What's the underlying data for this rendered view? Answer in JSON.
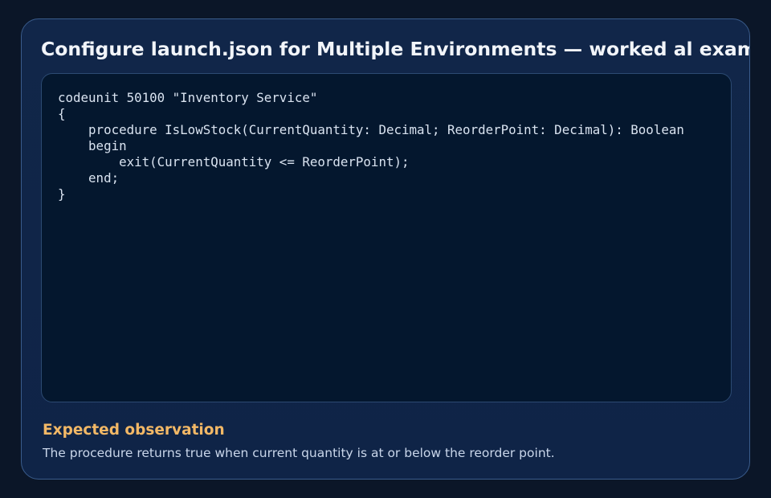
{
  "card": {
    "title": "Configure launch.json for Multiple Environments — worked al example",
    "code": {
      "lines": [
        "codeunit 50100 \"Inventory Service\"",
        "{",
        "    procedure IsLowStock(CurrentQuantity: Decimal; ReorderPoint: Decimal): Boolean",
        "    begin",
        "        exit(CurrentQuantity <= ReorderPoint);",
        "    end;",
        "}"
      ]
    },
    "observation": {
      "heading": "Expected observation",
      "text": "The procedure returns true when current quantity is at or below the reorder point."
    }
  },
  "colors": {
    "page_background": "#0b1628",
    "card_background": "#112649",
    "code_background": "#04172e",
    "title": "#f2f5fa",
    "observation_heading": "#f2b866",
    "observation_text": "#c9d6ea"
  }
}
